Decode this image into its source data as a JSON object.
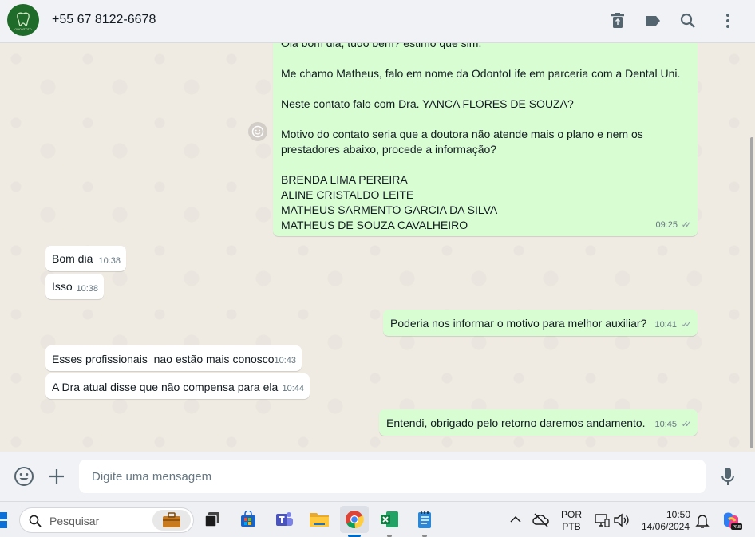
{
  "header": {
    "contact_name": "+55 67 8122-6678",
    "avatar_text": "ODONTOTO",
    "icons": [
      "delete-icon",
      "label-icon",
      "search-icon",
      "menu-icon"
    ]
  },
  "messages": [
    {
      "direction": "out",
      "lines": [
        "Olá bom dia, tudo bem? estimo que sim.",
        "",
        "Me chamo Matheus, falo em nome da OdontoLife em parceria com a Dental Uni.",
        "",
        "Neste contato falo com Dra. YANCA FLORES DE SOUZA?",
        "",
        "Motivo do contato seria que a doutora não atende mais o plano e nem os",
        "prestadores abaixo, procede a informação?",
        "",
        "BRENDA LIMA PEREIRA",
        "ALINE CRISTALDO LEITE",
        "MATHEUS SARMENTO GARCIA DA SILVA",
        "MATHEUS DE SOUZA CAVALHEIRO"
      ],
      "time": "09:25"
    },
    {
      "direction": "in",
      "text": "Bom dia",
      "time": "10:38"
    },
    {
      "direction": "in",
      "text": "Isso",
      "time": "10:38"
    },
    {
      "direction": "out",
      "text": "Poderia nos informar o motivo para melhor auxiliar?",
      "time": "10:41"
    },
    {
      "direction": "in",
      "text": "Esses profissionais  nao estão mais conosco",
      "time": "10:43"
    },
    {
      "direction": "in",
      "text": "A Dra atual disse que não compensa para ela",
      "time": "10:44"
    },
    {
      "direction": "out",
      "text": "Entendi, obrigado pelo retorno daremos andamento.",
      "time": "10:45"
    }
  ],
  "input": {
    "placeholder": "Digite uma mensagem"
  },
  "taskbar": {
    "search_placeholder": "Pesquisar",
    "language_top": "POR",
    "language_bottom": "PTB",
    "time": "10:50",
    "date": "14/06/2024",
    "copilot_badge": "PRE"
  },
  "colors": {
    "outgoing_bubble": "#d9fdd3",
    "incoming_bubble": "#ffffff",
    "chat_background": "#efeae2",
    "header_background": "#f0f2f5"
  }
}
